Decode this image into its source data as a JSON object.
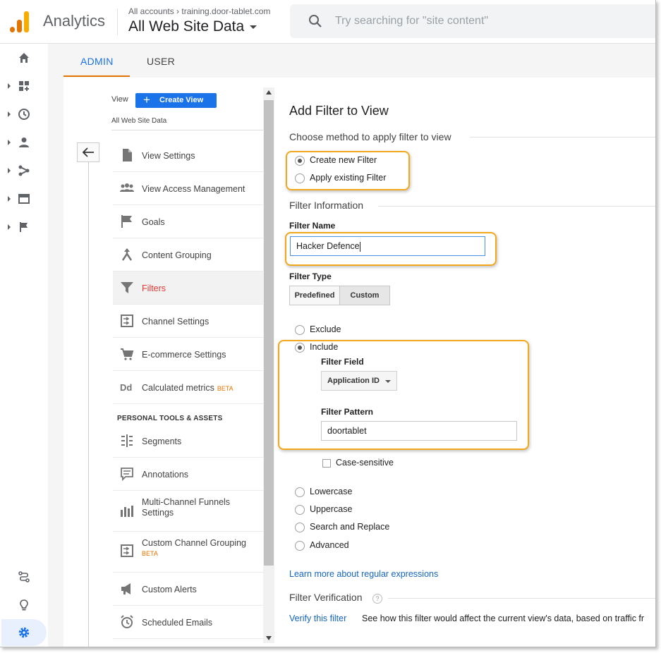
{
  "header": {
    "app_title": "Analytics",
    "breadcrumb": "All accounts › training.door-tablet.com",
    "property": "All Web Site Data",
    "search_placeholder": "Try searching for \"site content\""
  },
  "tabs": [
    {
      "label": "ADMIN",
      "active": true
    },
    {
      "label": "USER",
      "active": false
    }
  ],
  "view_panel": {
    "view_label": "View",
    "create_view": "Create View",
    "view_name": "All Web Site Data",
    "items": [
      {
        "label": "View Settings",
        "icon": "document-icon"
      },
      {
        "label": "View Access Management",
        "icon": "people-icon"
      },
      {
        "label": "Goals",
        "icon": "flag-icon"
      },
      {
        "label": "Content Grouping",
        "icon": "merge-icon"
      },
      {
        "label": "Filters",
        "icon": "filter-icon",
        "active": true
      },
      {
        "label": "Channel Settings",
        "icon": "channel-icon"
      },
      {
        "label": "E-commerce Settings",
        "icon": "cart-icon"
      },
      {
        "label": "Calculated metrics",
        "badge": "BETA",
        "icon": "dd-icon"
      }
    ],
    "section_title": "PERSONAL TOOLS & ASSETS",
    "tools": [
      {
        "label": "Segments",
        "icon": "segments-icon"
      },
      {
        "label": "Annotations",
        "icon": "annotation-icon"
      },
      {
        "label": "Multi-Channel Funnels Settings",
        "line1": "Multi-Channel Funnels",
        "line2": "Settings",
        "icon": "funnel-icon"
      },
      {
        "label": "Custom Channel Grouping",
        "badge": "BETA",
        "icon": "custom-channel-icon"
      },
      {
        "label": "Custom Alerts",
        "icon": "megaphone-icon"
      },
      {
        "label": "Scheduled Emails",
        "icon": "clock-mail-icon"
      }
    ]
  },
  "form": {
    "title": "Add Filter to View",
    "method_heading": "Choose method to apply filter to view",
    "method_options": [
      "Create new Filter",
      "Apply existing Filter"
    ],
    "method_selected": "Create new Filter",
    "info_heading": "Filter Information",
    "name_label": "Filter Name",
    "name_value": "Hacker Defence",
    "type_label": "Filter Type",
    "type_options": [
      "Predefined",
      "Custom"
    ],
    "type_selected": "Custom",
    "custom_options": [
      "Exclude",
      "Include"
    ],
    "custom_selected": "Include",
    "field_label": "Filter Field",
    "field_value": "Application ID",
    "pattern_label": "Filter Pattern",
    "pattern_value": "doortablet",
    "case_sensitive_label": "Case-sensitive",
    "other_options": [
      "Lowercase",
      "Uppercase",
      "Search and Replace",
      "Advanced"
    ],
    "learn_more": "Learn more about regular expressions",
    "verification_heading": "Filter Verification",
    "help_glyph": "?",
    "verify_link": "Verify this filter",
    "verify_desc": "See how this filter would affect the current view's data, based on traffic fr"
  },
  "colors": {
    "accent_blue": "#1a73e8",
    "active_red": "#e53935",
    "highlight_orange": "#f2a81d",
    "tab_underline": "#e37400"
  }
}
